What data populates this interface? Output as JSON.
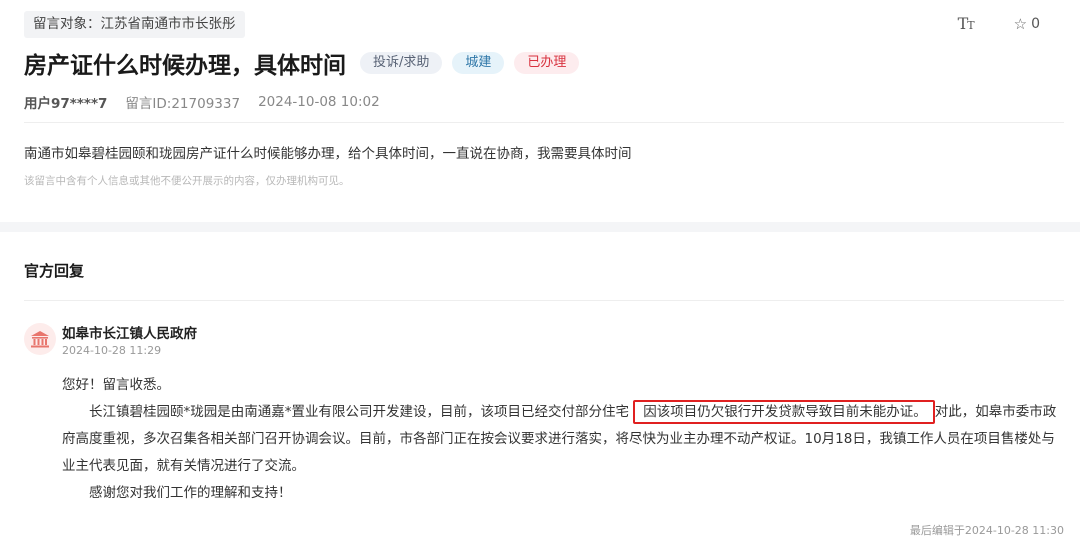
{
  "message": {
    "target": "留言对象：江苏省南通市市长张彤",
    "font_toggle_label_large": "T",
    "font_toggle_label_small": "T",
    "favorite_count": "0",
    "title": "房产证什么时候办理，具体时间",
    "tags": {
      "type": "投诉/求助",
      "domain": "城建",
      "status": "已办理"
    },
    "user": "用户97****7",
    "message_id": "留言ID:21709337",
    "datetime": "2024-10-08 10:02",
    "body": "南通市如皋碧桂园颐和珑园房产证什么时候能够办理，给个具体时间，一直说在协商，我需要具体时间",
    "privacy_note": "该留言中含有个人信息或其他不便公开展示的内容，仅办理机构可见。"
  },
  "reply": {
    "heading": "官方回复",
    "org_name": "如皋市长江镇人民政府",
    "date": "2024-10-28 11:29",
    "greeting": "您好！留言收悉。",
    "para1_before": "长江镇碧桂园颐*珑园是由南通嘉*置业有限公司开发建设，目前，该项目已经交付部分住宅",
    "para1_highlight": "因该项目仍欠银行开发贷款导致目前未能办证。",
    "para1_after": "对此，如皋市委市政府高度重视，多次召集各相关部门召开协调会议。目前，市各部门正在按会议要求进行落实，将尽快为业主办理不动产权证。10月18日，我镇工作人员在项目售楼处与业主代表见面，就有关情况进行了交流。",
    "closing": "感谢您对我们工作的理解和支持！",
    "last_edited": "最后编辑于2024-10-28 11:30"
  },
  "colors": {
    "status_red": "#d8323f",
    "highlight_border": "#e02020",
    "domain_blue": "#2f77a8"
  },
  "icons": {
    "font_size": "font-size-icon",
    "favorite": "star-outline-icon",
    "org_avatar": "government-building-icon"
  }
}
